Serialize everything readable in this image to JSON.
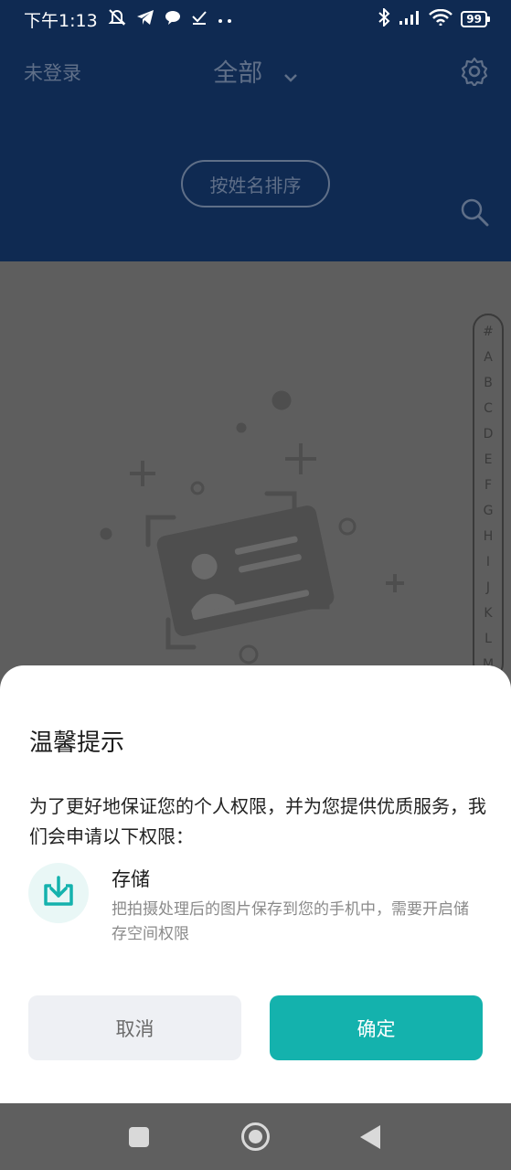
{
  "status_bar": {
    "time": "下午1:13",
    "battery": "99",
    "icons": [
      "mute-icon",
      "telegram-icon",
      "chat-icon",
      "check-icon",
      "more-dots-icon",
      "bluetooth-icon",
      "signal-icon",
      "wifi-icon",
      "battery-icon"
    ]
  },
  "header": {
    "login_status": "未登录",
    "filter_title": "全部",
    "sort_button": "按姓名排序"
  },
  "alpha_index": [
    "#",
    "A",
    "B",
    "C",
    "D",
    "E",
    "F",
    "G",
    "H",
    "I",
    "J",
    "K",
    "L",
    "M"
  ],
  "dialog": {
    "title": "温馨提示",
    "description": "为了更好地保证您的个人权限，并为您提供优质服务，我们会申请以下权限：",
    "permission": {
      "name": "存储",
      "description": "把拍摄处理后的图片保存到您的手机中，需要开启储存空间权限"
    },
    "cancel_label": "取消",
    "confirm_label": "确定"
  },
  "colors": {
    "header_bg": "#0f2a52",
    "accent": "#14b2ad",
    "cancel_bg": "#eef0f4"
  }
}
